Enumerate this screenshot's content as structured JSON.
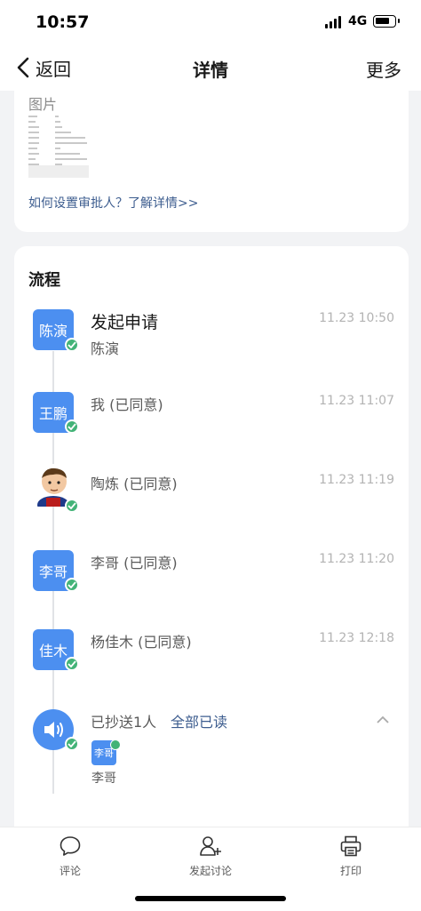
{
  "status": {
    "time": "10:57",
    "network": "4G"
  },
  "nav": {
    "back_label": "返回",
    "title": "详情",
    "more_label": "更多"
  },
  "attachment": {
    "label": "图片",
    "help_link": "如何设置审批人？了解详情>>"
  },
  "flow": {
    "title": "流程",
    "steps": [
      {
        "avatar": "陈演",
        "name": "发起申请",
        "sub": "陈演",
        "time": "11.23 10:50"
      },
      {
        "avatar": "王鹏",
        "name": "我 (已同意)",
        "time": "11.23 11:07"
      },
      {
        "avatar": "",
        "name": "陶炼 (已同意)",
        "time": "11.23 11:19"
      },
      {
        "avatar": "李哥",
        "name": "李哥 (已同意)",
        "time": "11.23 11:20"
      },
      {
        "avatar": "佳木",
        "name": "杨佳木 (已同意)",
        "time": "11.23 12:18"
      }
    ],
    "cc": {
      "label": "已抄送1人",
      "status": "全部已读",
      "recipient_avatar": "李哥",
      "recipient_name": "李哥"
    }
  },
  "bottom": {
    "comment": "评论",
    "discuss": "发起讨论",
    "print": "打印"
  },
  "colors": {
    "accent": "#4c8ff0",
    "check": "#43b377",
    "link": "#3d5d8f"
  }
}
